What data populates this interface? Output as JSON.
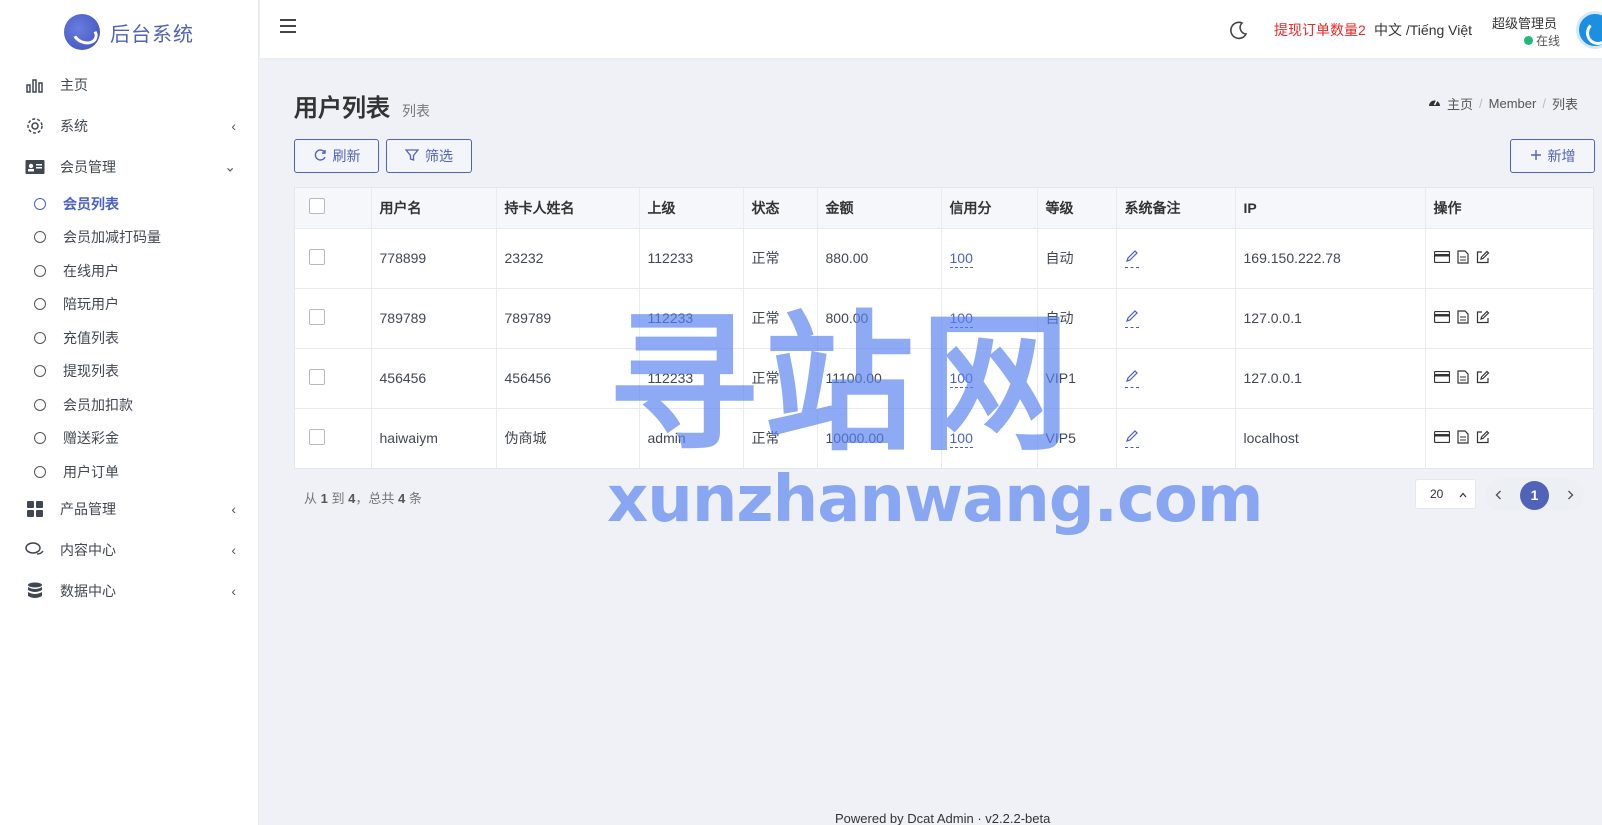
{
  "brand": {
    "name": "后台系统"
  },
  "sidebar": {
    "items": [
      {
        "label": "主页",
        "icon": "bar-chart-icon"
      },
      {
        "label": "系统",
        "icon": "gear-icon",
        "arrow": "‹"
      },
      {
        "label": "会员管理",
        "icon": "id-card-icon",
        "arrow": "⌄"
      }
    ],
    "sub_items": [
      {
        "label": "会员列表",
        "active": true
      },
      {
        "label": "会员加减打码量"
      },
      {
        "label": "在线用户"
      },
      {
        "label": "陪玩用户"
      },
      {
        "label": "充值列表"
      },
      {
        "label": "提现列表"
      },
      {
        "label": "会员加扣款"
      },
      {
        "label": "赠送彩金"
      },
      {
        "label": "用户订单"
      }
    ],
    "items_after": [
      {
        "label": "产品管理",
        "icon": "grid-icon",
        "arrow": "‹"
      },
      {
        "label": "内容中心",
        "icon": "chat-icon",
        "arrow": "‹"
      },
      {
        "label": "数据中心",
        "icon": "database-icon",
        "arrow": "‹"
      }
    ]
  },
  "topbar": {
    "withdraw_alert": "提现订单数量2",
    "language": "中文 /Tiếng Việt",
    "user_name": "超级管理员",
    "user_status": "在线",
    "colors": {
      "alert": "#ea2828",
      "online": "#21b978"
    }
  },
  "page": {
    "title": "用户列表",
    "description": "列表",
    "breadcrumb": [
      "主页",
      "Member",
      "列表"
    ]
  },
  "toolbar": {
    "refresh_label": "刷新",
    "filter_label": "筛选",
    "add_label": "新增"
  },
  "table": {
    "headers": [
      "用户名",
      "持卡人姓名",
      "上级",
      "状态",
      "金额",
      "信用分",
      "等级",
      "系统备注",
      "IP",
      "操作"
    ],
    "rows": [
      {
        "username": "778899",
        "cardholder": "23232",
        "parent": "112233",
        "status": "正常",
        "amount": "880.00",
        "credit": "100",
        "level": "自动",
        "ip": "169.150.222.78"
      },
      {
        "username": "789789",
        "cardholder": "789789",
        "parent": "112233",
        "status": "正常",
        "amount": "800.00",
        "credit": "100",
        "level": "自动",
        "ip": "127.0.0.1"
      },
      {
        "username": "456456",
        "cardholder": "456456",
        "parent": "112233",
        "status": "正常",
        "amount": "11100.00",
        "credit": "100",
        "level": "VIP1",
        "ip": "127.0.0.1"
      },
      {
        "username": "haiwaiym",
        "cardholder": "伪商城",
        "parent": "admin",
        "status": "正常",
        "amount": "10000.00",
        "credit": "100",
        "level": "VIP5",
        "ip": "localhost"
      }
    ]
  },
  "pagination": {
    "from_text": "从",
    "from": "1",
    "to_text": "到",
    "to": "4",
    "total_text": "，总共",
    "total": "4",
    "unit": "条",
    "per_page": "20",
    "current_page": "1"
  },
  "footer": {
    "text": "Powered by Dcat Admin · v2.2.2-beta"
  },
  "watermark": {
    "cn": "寻站网",
    "en": "xunzhanwang.com"
  }
}
